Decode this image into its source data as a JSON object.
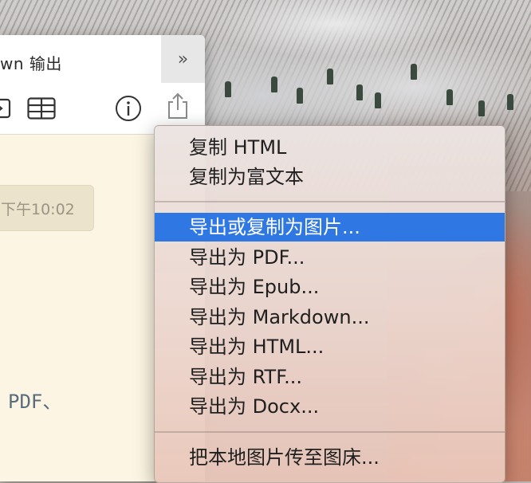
{
  "panel": {
    "title": "wn 输出",
    "expand_glyph": "»",
    "toolbar_icons": [
      "partial-icon",
      "table-icon",
      "info-icon",
      "share-icon"
    ]
  },
  "editor": {
    "time_badge": "下午10:02",
    "body_text": "PDF、"
  },
  "menu": {
    "highlight_color": "#2f77e3",
    "group1": [
      "复制 HTML",
      "复制为富文本"
    ],
    "group2": [
      "导出或复制为图片...",
      "导出为 PDF...",
      "导出为 Epub...",
      "导出为 Markdown...",
      "导出为 HTML...",
      "导出为 RTF...",
      "导出为 Docx..."
    ],
    "group3": [
      "把本地图片传至图床..."
    ],
    "selected": "导出或复制为图片..."
  }
}
